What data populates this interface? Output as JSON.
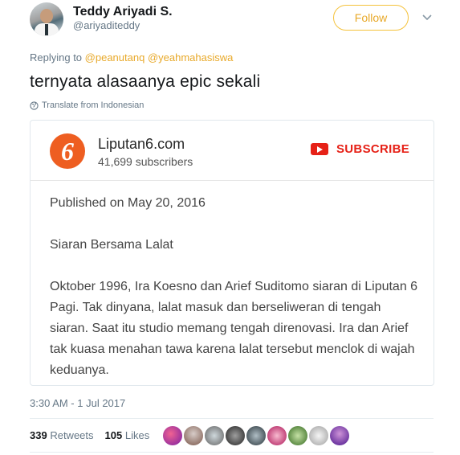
{
  "author": {
    "name": "Teddy Ariyadi S.",
    "handle": "@ariyaditeddy"
  },
  "follow_label": "Follow",
  "replying_to": {
    "prefix": "Replying to",
    "mention_1": "@peanutanq",
    "mention_2": "@yeahmahasiswa"
  },
  "tweet_text": "ternyata alasaanya epic sekali",
  "translate_label": "Translate from Indonesian",
  "card": {
    "channel_name": "Liputan6.com",
    "subscribers": "41,699 subscribers",
    "subscribe_label": "SUBSCRIBE",
    "logo_glyph": "6",
    "published": "Published on May 20, 2016",
    "video_title": "Siaran Bersama Lalat",
    "description": "Oktober 1996, Ira Koesno dan Arief Suditomo siaran di Liputan 6 Pagi. Tak dinyana, lalat masuk dan berseliweran di tengah siaran. Saat itu studio memang tengah direnovasi. Ira dan Arief tak kuasa menahan tawa karena lalat tersebut menclok di wajah keduanya."
  },
  "timestamp": "3:30 AM - 1 Jul 2017",
  "stats": {
    "retweets_count": "339",
    "retweets_label": "Retweets",
    "likes_count": "105",
    "likes_label": "Likes"
  },
  "colors": {
    "follow": "#f5c23b",
    "mention": "#e8a92a",
    "youtube_red": "#e62117",
    "liputan_orange": "#ee5e21"
  },
  "icons": [
    "globe-icon",
    "chevron-down-icon",
    "youtube-icon"
  ]
}
